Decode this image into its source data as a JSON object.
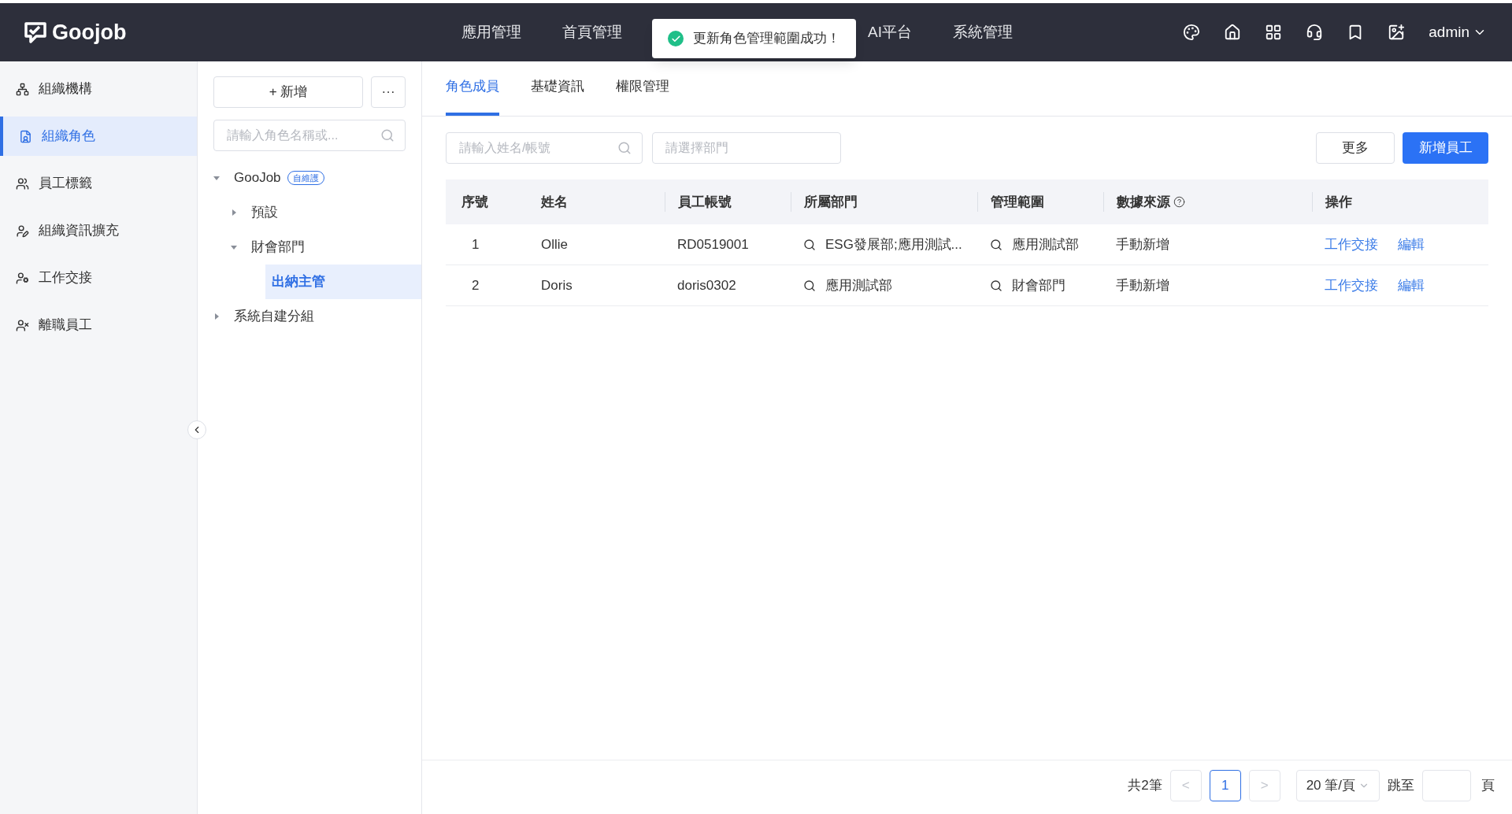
{
  "header": {
    "logo": "Goojob",
    "nav": [
      {
        "label": "應用管理"
      },
      {
        "label": "首頁管理"
      },
      {
        "label": "AI平台"
      },
      {
        "label": "系統管理"
      }
    ],
    "user": "admin"
  },
  "toast": {
    "message": "更新角色管理範圍成功！"
  },
  "sidebar": {
    "items": [
      {
        "label": "組織機構",
        "selected": false
      },
      {
        "label": "組織角色",
        "selected": true
      },
      {
        "label": "員工標籤",
        "selected": false
      },
      {
        "label": "組織資訊擴充",
        "selected": false
      },
      {
        "label": "工作交接",
        "selected": false
      },
      {
        "label": "離職員工",
        "selected": false
      }
    ]
  },
  "role_panel": {
    "add_button": "+ 新增",
    "more_button": "···",
    "search": {
      "placeholder": "請輸入角色名稱或..."
    },
    "tree": [
      {
        "label": "GooJob",
        "kind": "group",
        "badge": "自維護",
        "expanded": true,
        "selected": false,
        "children": [
          {
            "label": "預設",
            "kind": "group",
            "expanded": false,
            "selected": false
          },
          {
            "label": "財會部門",
            "kind": "group",
            "expanded": true,
            "selected": false,
            "children": [
              {
                "label": "出納主管",
                "kind": "leaf",
                "selected": true
              }
            ]
          }
        ]
      },
      {
        "label": "系統自建分組",
        "kind": "group",
        "expanded": false,
        "selected": false
      }
    ]
  },
  "tabs": [
    {
      "label": "角色成員",
      "selected": true
    },
    {
      "label": "基礎資訊",
      "selected": false
    },
    {
      "label": "權限管理",
      "selected": false
    }
  ],
  "filters": {
    "name_search": {
      "placeholder": "請輸入姓名/帳號"
    },
    "department": {
      "placeholder": "請選擇部門"
    }
  },
  "actions": [
    "更多",
    "新增員工"
  ],
  "table": {
    "columns": [
      "序號",
      "姓名",
      "員工帳號",
      "所屬部門",
      "管理範圍",
      "數據來源",
      "操作"
    ],
    "rows": [
      {
        "cells": [
          "1",
          "Ollie",
          "RD0519001",
          "ESG發展部;應用測試...",
          "應用測試部",
          "手動新增"
        ],
        "actions": [
          "工作交接",
          "編輯"
        ]
      },
      {
        "cells": [
          "2",
          "Doris",
          "doris0302",
          "應用測試部",
          "財會部門",
          "手動新增"
        ],
        "actions": [
          "工作交接",
          "編輯"
        ]
      }
    ]
  },
  "pagination": {
    "total": "共2筆",
    "prev": "<",
    "pages": [
      {
        "label": "1",
        "selected": true
      }
    ],
    "next": ">",
    "page_size": "20 筆/頁",
    "jump_label": "跳至",
    "jump_suffix": "頁"
  }
}
